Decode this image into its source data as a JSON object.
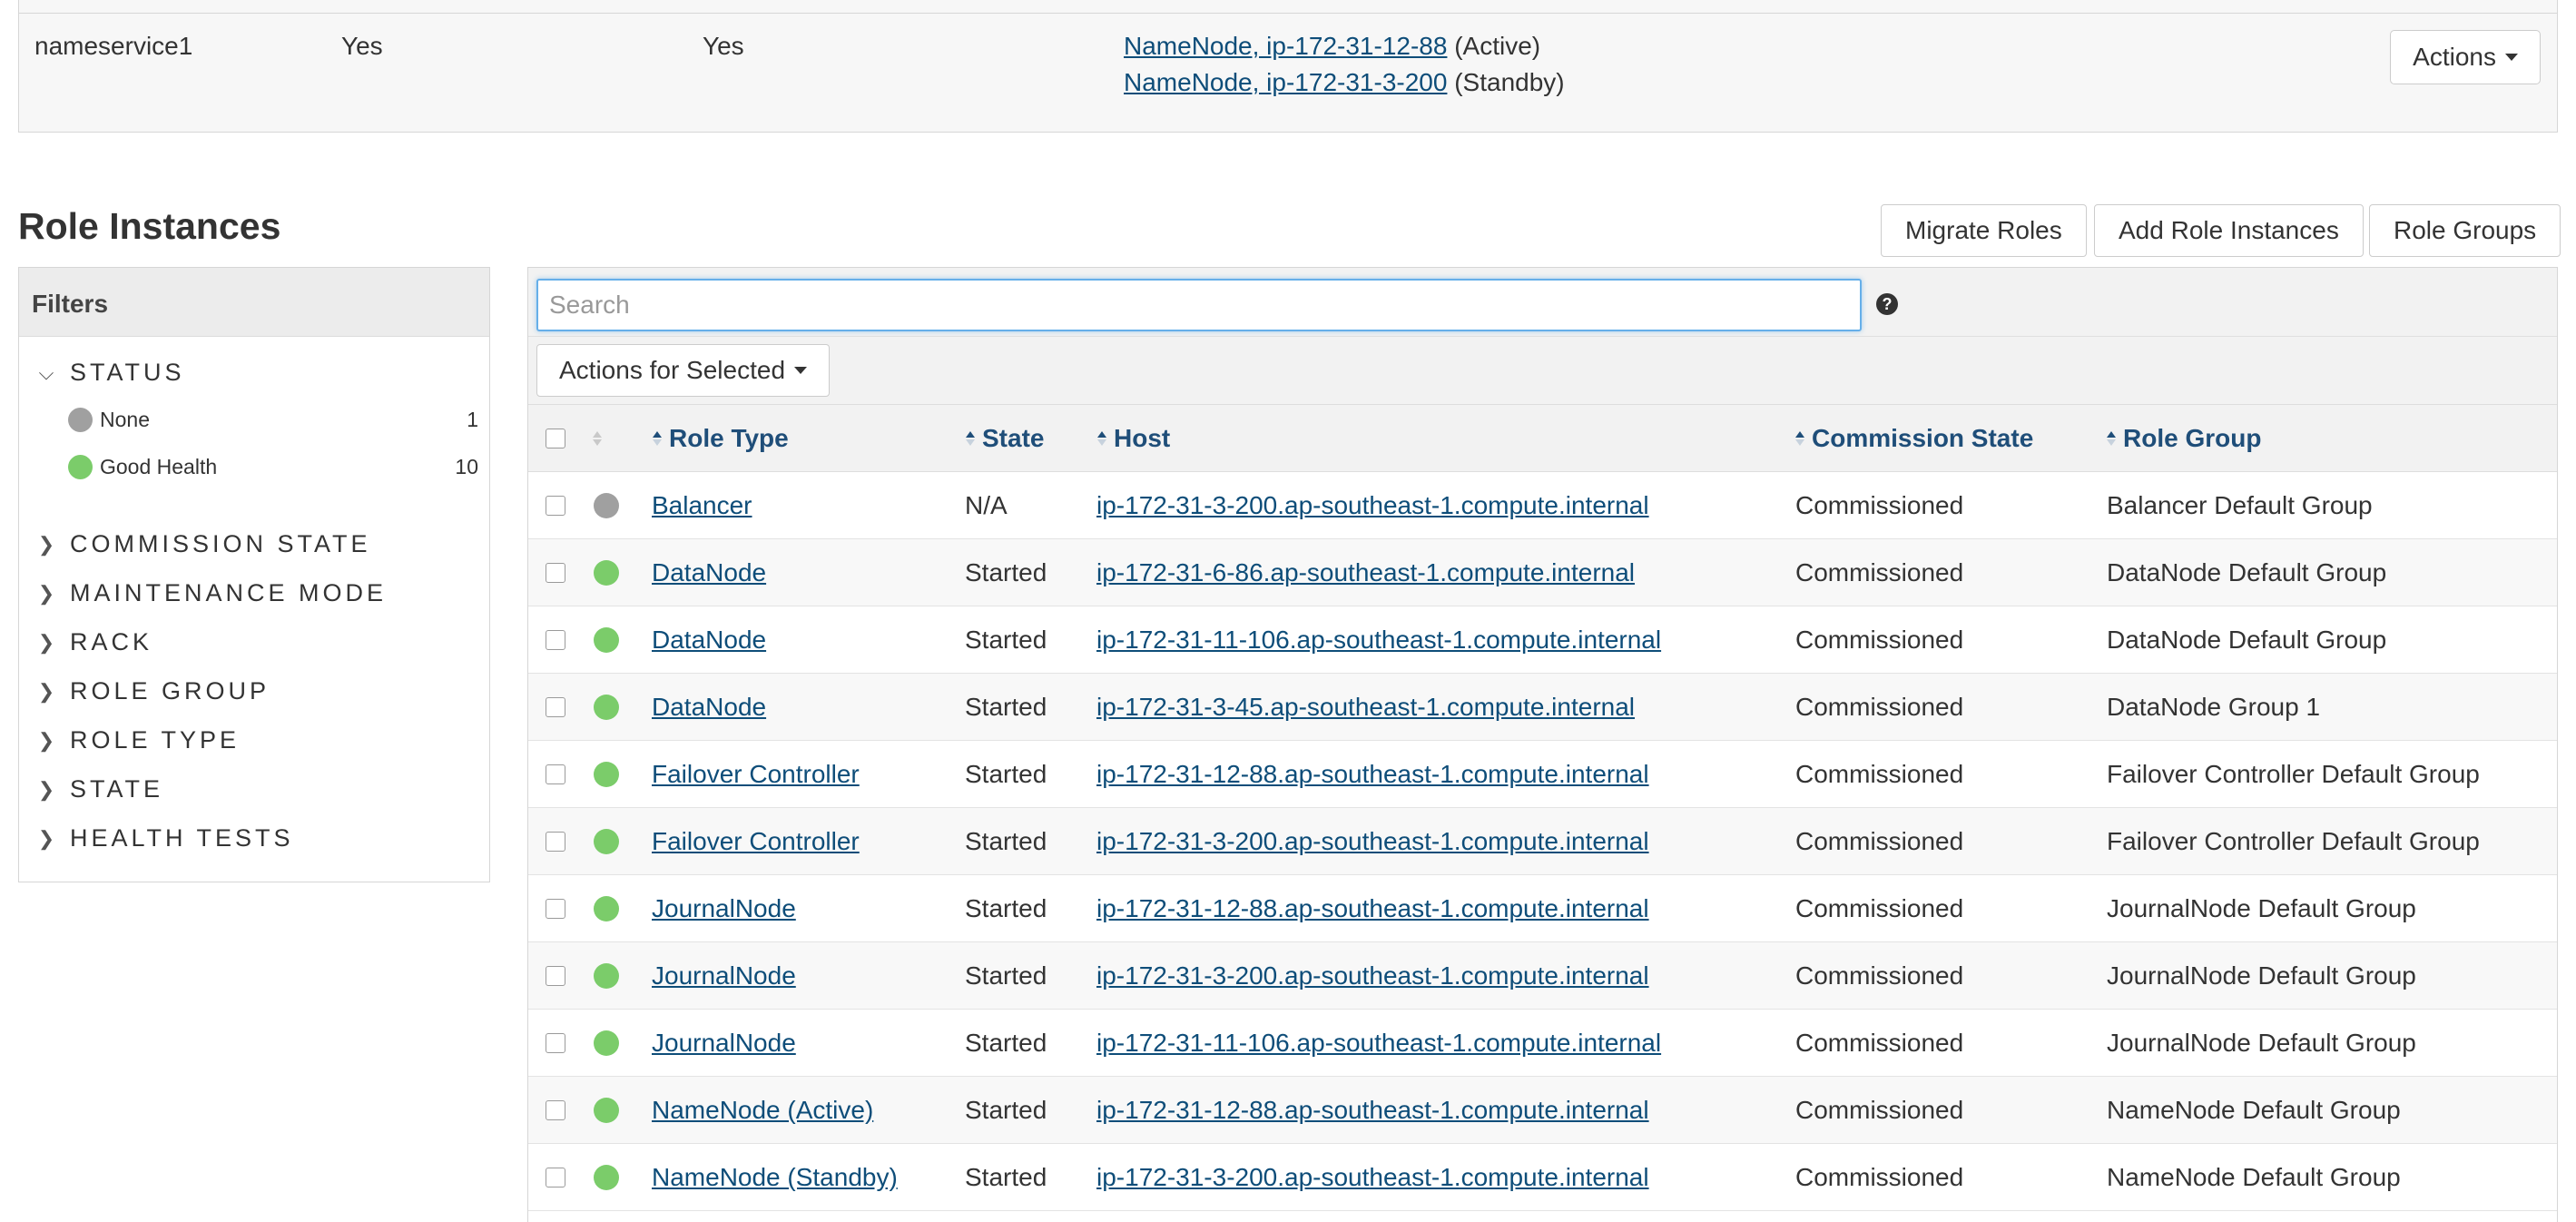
{
  "nameservice": {
    "name": "nameservice1",
    "col2": "Yes",
    "col3": "Yes",
    "namenodes": [
      {
        "link": "NameNode, ip-172-31-12-88",
        "suffix": "(Active)"
      },
      {
        "link": "NameNode, ip-172-31-3-200",
        "suffix": "(Standby)"
      }
    ],
    "actions_label": "Actions"
  },
  "section_title": "Role Instances",
  "top_buttons": {
    "migrate": "Migrate Roles",
    "add": "Add Role Instances",
    "groups": "Role Groups"
  },
  "filters": {
    "title": "Filters",
    "status": {
      "label": "STATUS",
      "items": [
        {
          "label": "None",
          "count": "1",
          "color": "#a0a0a0"
        },
        {
          "label": "Good Health",
          "count": "10",
          "color": "#7bcc6a"
        }
      ]
    },
    "groups": [
      "COMMISSION STATE",
      "MAINTENANCE MODE",
      "RACK",
      "ROLE GROUP",
      "ROLE TYPE",
      "STATE",
      "HEALTH TESTS"
    ]
  },
  "search": {
    "placeholder": "Search",
    "value": ""
  },
  "actions_for_selected": "Actions for Selected",
  "table": {
    "headers": {
      "role_type": "Role Type",
      "state": "State",
      "host": "Host",
      "commission_state": "Commission State",
      "role_group": "Role Group"
    },
    "rows": [
      {
        "status": "none",
        "role_type": "Balancer",
        "state": "N/A",
        "host": "ip-172-31-3-200.ap-southeast-1.compute.internal",
        "commission": "Commissioned",
        "group": "Balancer Default Group"
      },
      {
        "status": "good",
        "role_type": "DataNode",
        "state": "Started",
        "host": "ip-172-31-6-86.ap-southeast-1.compute.internal",
        "commission": "Commissioned",
        "group": "DataNode Default Group"
      },
      {
        "status": "good",
        "role_type": "DataNode",
        "state": "Started",
        "host": "ip-172-31-11-106.ap-southeast-1.compute.internal",
        "commission": "Commissioned",
        "group": "DataNode Default Group"
      },
      {
        "status": "good",
        "role_type": "DataNode",
        "state": "Started",
        "host": "ip-172-31-3-45.ap-southeast-1.compute.internal",
        "commission": "Commissioned",
        "group": "DataNode Group 1"
      },
      {
        "status": "good",
        "role_type": "Failover Controller",
        "state": "Started",
        "host": "ip-172-31-12-88.ap-southeast-1.compute.internal",
        "commission": "Commissioned",
        "group": "Failover Controller Default Group"
      },
      {
        "status": "good",
        "role_type": "Failover Controller",
        "state": "Started",
        "host": "ip-172-31-3-200.ap-southeast-1.compute.internal",
        "commission": "Commissioned",
        "group": "Failover Controller Default Group"
      },
      {
        "status": "good",
        "role_type": "JournalNode",
        "state": "Started",
        "host": "ip-172-31-12-88.ap-southeast-1.compute.internal",
        "commission": "Commissioned",
        "group": "JournalNode Default Group"
      },
      {
        "status": "good",
        "role_type": "JournalNode",
        "state": "Started",
        "host": "ip-172-31-3-200.ap-southeast-1.compute.internal",
        "commission": "Commissioned",
        "group": "JournalNode Default Group"
      },
      {
        "status": "good",
        "role_type": "JournalNode",
        "state": "Started",
        "host": "ip-172-31-11-106.ap-southeast-1.compute.internal",
        "commission": "Commissioned",
        "group": "JournalNode Default Group"
      },
      {
        "status": "good",
        "role_type": "NameNode (Active)",
        "state": "Started",
        "host": "ip-172-31-12-88.ap-southeast-1.compute.internal",
        "commission": "Commissioned",
        "group": "NameNode Default Group"
      },
      {
        "status": "good",
        "role_type": "NameNode (Standby)",
        "state": "Started",
        "host": "ip-172-31-3-200.ap-southeast-1.compute.internal",
        "commission": "Commissioned",
        "group": "NameNode Default Group"
      }
    ]
  },
  "colors": {
    "link": "#0e4d79",
    "header_text": "#1f4e79",
    "good": "#7bcc6a",
    "none": "#a0a0a0",
    "focus": "#66afe9"
  }
}
